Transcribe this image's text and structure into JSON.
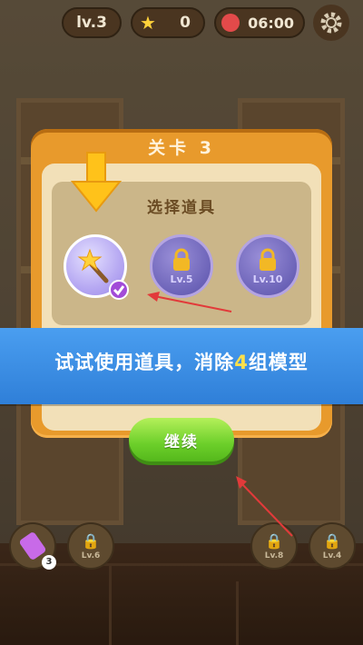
{
  "topbar": {
    "level": "lv.3",
    "stars": "0",
    "timer": "06:00"
  },
  "dialog": {
    "title": "关卡 3",
    "subtitle": "选择道具",
    "items": [
      {
        "name": "magic-wand",
        "state": "selected",
        "label": ""
      },
      {
        "name": "locked-item",
        "state": "locked",
        "label": "Lv.5"
      },
      {
        "name": "locked-item",
        "state": "locked",
        "label": "Lv.10"
      }
    ],
    "continue_label": "继续"
  },
  "banner": {
    "text_before": "试试使用道具，消除",
    "highlight": "4",
    "text_after": "组模型"
  },
  "tray": {
    "item_count": "3",
    "slots": [
      "Lv.6",
      "Lv.8",
      "Lv.4"
    ]
  },
  "colors": {
    "accent_orange": "#e89a2c",
    "banner_blue": "#3b8ee6",
    "button_green": "#6ccf2a",
    "highlight_yellow": "#ffe04a"
  }
}
